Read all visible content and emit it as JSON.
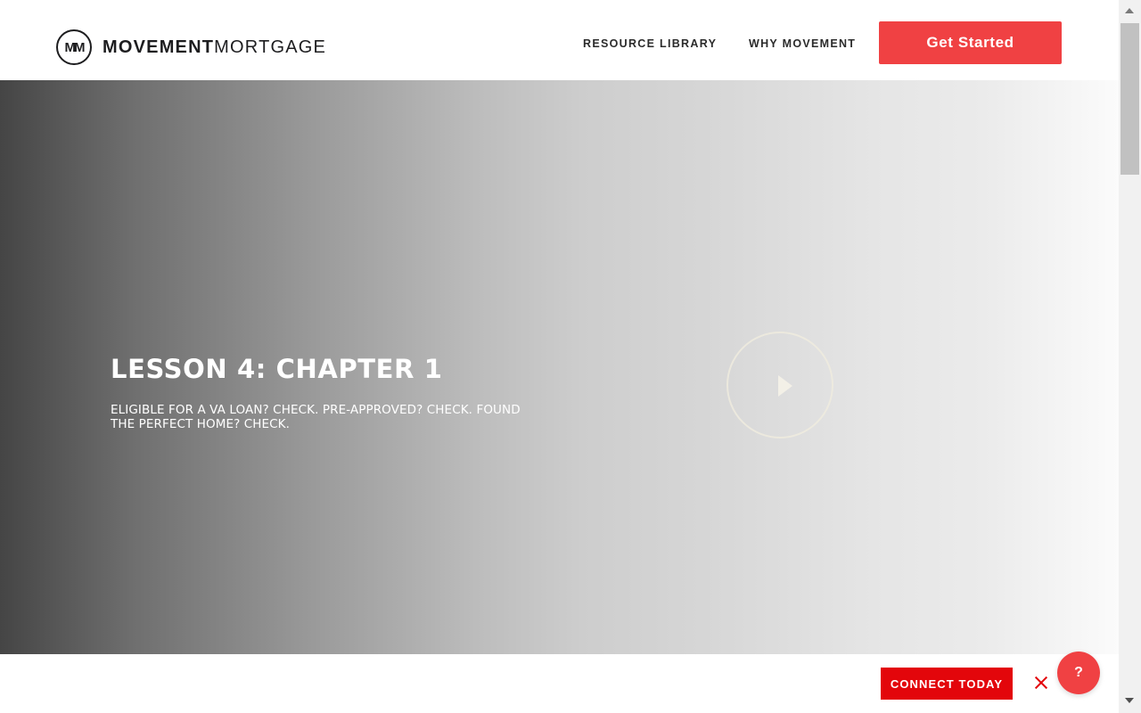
{
  "header": {
    "logo": {
      "mark": "MM",
      "name_bold": "MOVEMENT",
      "name_light": "MORTGAGE"
    },
    "nav": [
      {
        "label": "RESOURCE LIBRARY"
      },
      {
        "label": "WHY MOVEMENT"
      }
    ],
    "cta_label": "Get Started"
  },
  "hero": {
    "title": "LESSON 4: CHAPTER 1",
    "subtitle": "ELIGIBLE FOR A VA LOAN? CHECK. PRE-APPROVED? CHECK. FOUND THE PERFECT HOME? CHECK.",
    "play_icon": "play-icon"
  },
  "bottom_bar": {
    "connect_label": "CONNECT TODAY",
    "close_icon": "close-icon"
  },
  "help_label": "?",
  "colors": {
    "brand_red": "#f04143",
    "connect_red": "#e3060b",
    "text_dark": "#1d1d1f"
  }
}
